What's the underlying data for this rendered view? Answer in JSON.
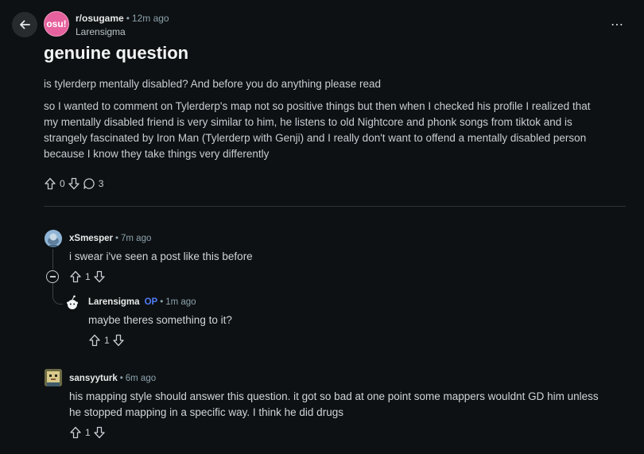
{
  "post": {
    "subreddit": "r/osugame",
    "subreddit_icon_text": "osu!",
    "age": "12m ago",
    "author": "Larensigma",
    "title": "genuine question",
    "paragraph1": "is tylerderp mentally disabled? And before you do anything please read",
    "paragraph2_lines": [
      "so I wanted to comment on Tylerderp's map not so positive things but then when I checked his profile I realized that",
      "my mentally disabled friend is very similar to him, he listens to old Nightcore and phonk songs from tiktok and is",
      "strangely fascinated by Iron Man (Tylerderp with Genji) and I really don't want to offend a mentally disabled person",
      "because I know they take things very differently"
    ],
    "score": "0",
    "comment_count": "3",
    "separator": "•",
    "more_icon": "⋯"
  },
  "comments": [
    {
      "author": "xSmesper",
      "age": "7m ago",
      "text": "i swear i've seen a post like this before",
      "score": "1"
    },
    {
      "author": "Larensigma",
      "op_label": "OP",
      "age": "1m ago",
      "text": "maybe theres something to it?",
      "score": "1"
    },
    {
      "author": "sansyyturk",
      "age": "6m ago",
      "text_lines": [
        "his mapping style should answer this question. it got so bad at one point some mappers wouldnt GD him unless",
        "he stopped mapping in a specific way. I think he did drugs"
      ],
      "score": "1"
    }
  ],
  "colors": {
    "background": "#0e1113",
    "accent_osu": "#e6619d",
    "op_blue": "#4f7cf7"
  }
}
